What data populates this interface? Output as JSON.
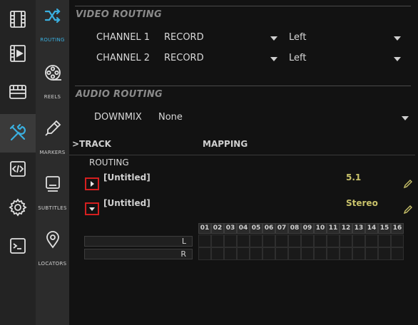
{
  "rail": {
    "items": [
      {
        "icon": "film-icon"
      },
      {
        "icon": "video-file-icon"
      },
      {
        "icon": "tray-icon"
      },
      {
        "icon": "tools-icon",
        "active": true
      },
      {
        "icon": "code-icon"
      },
      {
        "icon": "gear-icon"
      },
      {
        "icon": "terminal-icon"
      }
    ]
  },
  "nav": {
    "items": [
      {
        "label": "ROUTING",
        "icon": "shuffle-icon",
        "active": true
      },
      {
        "label": "REELS",
        "icon": "film-reel-icon"
      },
      {
        "label": "MARKERS",
        "icon": "marker-pen-icon"
      },
      {
        "label": "SUBTITLES",
        "icon": "subtitles-icon"
      },
      {
        "label": "LOCATORS",
        "icon": "location-pin-icon"
      }
    ]
  },
  "video_routing": {
    "title": "VIDEO ROUTING",
    "channels": [
      {
        "label": "CHANNEL 1",
        "source": "RECORD",
        "side": "Left"
      },
      {
        "label": "CHANNEL 2",
        "source": "RECORD",
        "side": "Left"
      }
    ]
  },
  "audio_routing": {
    "title": "AUDIO ROUTING",
    "downmix_label": "DOWNMIX",
    "downmix_value": "None",
    "col_track": ">TRACK",
    "col_mapping": "MAPPING",
    "routing_label": "ROUTING",
    "tracks": [
      {
        "name": "[Untitled]",
        "mapping": "5.1",
        "expanded": false
      },
      {
        "name": "[Untitled]",
        "mapping": "Stereo",
        "expanded": true
      }
    ],
    "channel_rows": [
      "L",
      "R"
    ],
    "channel_columns": [
      "01",
      "02",
      "03",
      "04",
      "05",
      "06",
      "07",
      "08",
      "09",
      "10",
      "11",
      "12",
      "13",
      "14",
      "15",
      "16"
    ]
  },
  "colors": {
    "accent": "#3ab0e0",
    "mapping": "#c9c26a",
    "highlight_box": "#d41f1f"
  }
}
